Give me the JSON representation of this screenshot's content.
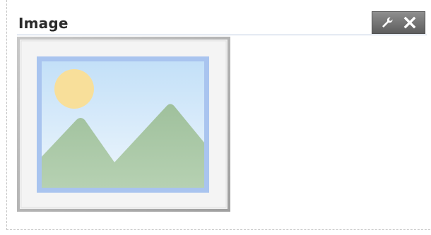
{
  "widget": {
    "title": "Image"
  },
  "toolbar": {
    "icons": [
      "wrench-icon",
      "close-icon"
    ]
  },
  "colors": {
    "frame_outer": "#b4b4b4",
    "frame_inner": "#f1f1f1",
    "photo_border": "#a9c4ef",
    "sky_top": "#c6e2f8",
    "sky_bottom": "#eaf4fb",
    "sun": "#f8df9a",
    "mountains": "#a9c8a6",
    "header_rule": "#b9c9de",
    "toolbar_bg": "#6f6f6f"
  }
}
